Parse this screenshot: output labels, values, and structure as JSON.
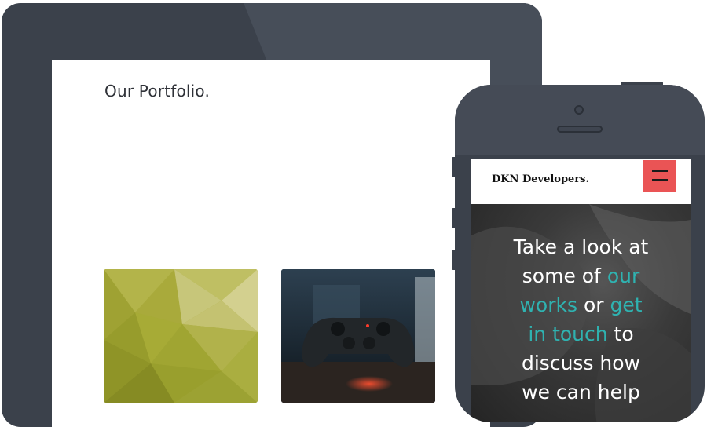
{
  "tablet": {
    "portfolio_title": "Our Portfolio.",
    "thumbnails": [
      {
        "name": "low-poly-artwork"
      },
      {
        "name": "game-controller-photo"
      }
    ]
  },
  "phone": {
    "brand": "DKN Developers.",
    "menu_icon": "hamburger-icon",
    "hero": {
      "line1": "Take a look at",
      "line2_a": "some of ",
      "line2_b": "our",
      "line3_a": "works",
      "line3_b": " or ",
      "line3_c": "get",
      "line4_a": "in touch",
      "line4_b": " to",
      "line5": "discuss how",
      "line6": "we can help"
    }
  },
  "colors": {
    "device_frame": "#3b414b",
    "accent_teal": "#2fb2b0",
    "menu_red": "#ea5455"
  }
}
